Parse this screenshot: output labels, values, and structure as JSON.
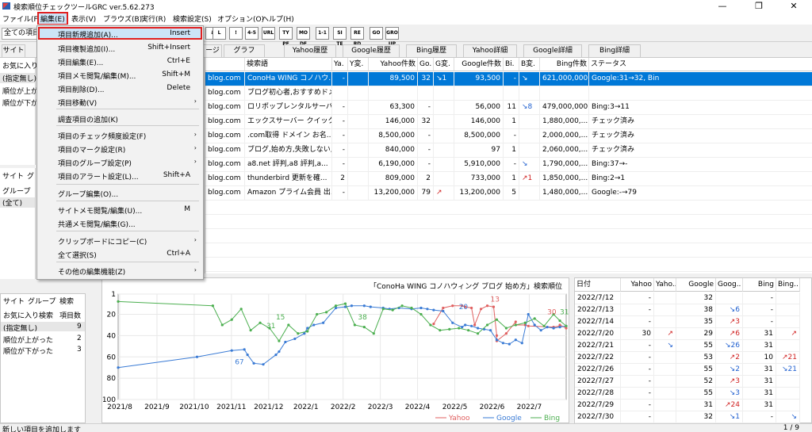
{
  "app": {
    "title": "検索順位チェックツールGRC  ver.5.62.273"
  },
  "window": {
    "minimize": "—",
    "restore": "❐",
    "close": "✕"
  },
  "menu": [
    "ファイル(F)",
    "編集(E)",
    "表示(V)",
    "ブラウズ(B)",
    "実行(R)",
    "検索設定(S)",
    "オプション(O)",
    "ヘルプ(H)"
  ],
  "filter": {
    "value": "全ての項目"
  },
  "toolbar": [
    "↓",
    "L",
    "!",
    "4-5",
    "URL",
    "TY PE",
    "MO DE",
    "1-1",
    "SI TE",
    "RE RD",
    "GO",
    "GRO UP"
  ],
  "tabs": [
    "サイト",
    "グラフ",
    "Yahoo履歴",
    "Google履歴",
    "Bing履歴",
    "Yahoo詳細",
    "Google詳細",
    "Bing詳細"
  ],
  "tab_partial": "ージ",
  "left_top": {
    "tabs": [
      "サイト",
      "グル"
    ],
    "items": [
      "お気に入り検",
      "(指定無し)",
      "順位が上が",
      "順位が下が"
    ]
  },
  "left_mid": {
    "tabs": [
      "サイト",
      "グ"
    ],
    "header": "グループ",
    "items": [
      "(全て)"
    ]
  },
  "left_bottom": {
    "tabs": [
      "サイト",
      "グループ",
      "検索"
    ],
    "headers": [
      "お気に入り検索",
      "項目数"
    ],
    "rows": [
      [
        "(指定無し)",
        "9"
      ],
      [
        "順位が上がった",
        "2"
      ],
      [
        "順位が下がった",
        "3"
      ]
    ]
  },
  "grid": {
    "headers": [
      "",
      "検索語",
      "Ya.",
      "Y変.",
      "Yahoo件数",
      "Go.",
      "G変.",
      "Google件数",
      "Bi.",
      "B変.",
      "Bing件数",
      "ステータス"
    ],
    "rows": [
      [
        "blog.com",
        "ConoHa WING コノハウ...",
        "-",
        "",
        "89,500",
        "32",
        "↘1",
        "93,500",
        "-",
        "↘",
        "621,000,000",
        "Google:31→32, Bin"
      ],
      [
        "blog.com",
        "ブログ初心者,おすすめドメ...",
        "",
        "",
        "",
        "",
        "",
        "",
        "",
        "",
        "",
        ""
      ],
      [
        "blog.com",
        "ロリポップレンタルサーバー,...",
        "-",
        "",
        "63,300",
        "-",
        "",
        "56,000",
        "11",
        "↘8",
        "479,000,000",
        "Bing:3→11"
      ],
      [
        "blog.com",
        "エックスサーバー クイックスタ...",
        "-",
        "",
        "146,000",
        "32",
        "",
        "146,000",
        "1",
        "",
        "1,880,000,...",
        "チェック済み"
      ],
      [
        "blog.com",
        ".com取得 ドメイン お名...",
        "-",
        "",
        "8,500,000",
        "-",
        "",
        "8,500,000",
        "-",
        "",
        "2,000,000,...",
        "チェック済み"
      ],
      [
        "blog.com",
        "ブログ,始め方,失敗しない,...",
        "-",
        "",
        "840,000",
        "-",
        "",
        "97",
        "1",
        "",
        "2,060,000,...",
        "チェック済み"
      ],
      [
        "blog.com",
        "a8.net 評判,a8 評判,a...",
        "-",
        "",
        "6,190,000",
        "-",
        "",
        "5,910,000",
        "-",
        "↘",
        "1,790,000,...",
        "Bing:37→-"
      ],
      [
        "blog.com",
        "thunderbird 更新を確...",
        "2",
        "",
        "809,000",
        "2",
        "",
        "733,000",
        "1",
        "↗1",
        "1,850,000,...",
        "Bing:2→1"
      ],
      [
        "blog.com",
        "Amazon プライム会員 出...",
        "-",
        "",
        "13,200,000",
        "79",
        "↗",
        "13,200,000",
        "5",
        "",
        "1,480,000,...",
        "Google:-→79"
      ]
    ]
  },
  "dropdown": {
    "items": [
      {
        "label": "項目新規追加(A)...",
        "shortcut": "Insert"
      },
      {
        "label": "項目複製追加(I)...",
        "shortcut": "Shift+Insert"
      },
      {
        "label": "項目編集(E)...",
        "shortcut": "Ctrl+E"
      },
      {
        "label": "項目メモ閲覧/編集(M)...",
        "shortcut": "Shift+M"
      },
      {
        "label": "項目削除(D)...",
        "shortcut": "Delete"
      },
      {
        "label": "項目移動(V)",
        "shortcut": ""
      },
      {
        "label": "調査項目の追加(K)",
        "shortcut": ""
      },
      {
        "label": "項目のチェック頻度設定(F)",
        "shortcut": ""
      },
      {
        "label": "項目のマーク設定(R)",
        "shortcut": ""
      },
      {
        "label": "項目のグループ設定(P)",
        "shortcut": ""
      },
      {
        "label": "項目のアラート設定(L)...",
        "shortcut": "Shift+A"
      },
      {
        "label": "グループ編集(O)...",
        "shortcut": ""
      },
      {
        "label": "サイトメモ閲覧/編集(U)...",
        "shortcut": "M"
      },
      {
        "label": "共通メモ閲覧/編集(G)...",
        "shortcut": ""
      },
      {
        "label": "クリップボードにコピー(C)",
        "shortcut": ""
      },
      {
        "label": "全て選択(S)",
        "shortcut": "Ctrl+A"
      },
      {
        "label": "その他の編集機能(Z)",
        "shortcut": ""
      }
    ]
  },
  "chart_data": {
    "type": "line",
    "title": "「ConoHa WING コノハウィング ブログ 始め方」検索順位",
    "x_ticks": [
      "2021/8",
      "2021/9",
      "2021/10",
      "2021/11",
      "2021/12",
      "2022/1",
      "2022/2",
      "2022/3",
      "2022/4",
      "2022/5",
      "2022/6",
      "2022/7"
    ],
    "y_ticks": [
      1,
      20,
      40,
      60,
      80,
      100
    ],
    "ylim": [
      1,
      100
    ],
    "y_inverted": true,
    "annotations": [
      "13",
      "20",
      "38",
      "30",
      "31",
      "67",
      "15",
      "31"
    ],
    "series": [
      {
        "name": "Yahoo",
        "color": "#e06060",
        "x": [
          10.0,
          10.3,
          10.6,
          10.9,
          11.0,
          11.2,
          11.3,
          11.5,
          11.7,
          11.9,
          12.0,
          12.0,
          12.3,
          12.6,
          12.6,
          12.9,
          13.0,
          13.8,
          14.0,
          14.0,
          14.2
        ],
        "y": [
          29,
          14,
          12,
          12,
          13,
          14,
          30,
          15,
          12,
          13,
          40,
          45,
          38,
          27,
          30,
          30,
          31,
          32,
          31,
          30,
          33
        ]
      },
      {
        "name": "Google",
        "color": "#3a7bd5",
        "x": [
          0.0,
          2.5,
          3.6,
          4.0,
          4.1,
          4.3,
          4.6,
          5.0,
          5.1,
          5.3,
          5.6,
          5.9,
          6.0,
          6.2,
          6.5,
          6.9,
          7.2,
          7.4,
          7.8,
          8.0,
          8.4,
          8.6,
          8.9,
          9.3,
          9.6,
          9.8,
          10.0,
          10.3,
          10.6,
          10.9,
          11.0,
          11.2,
          11.4,
          11.6,
          11.8,
          12.0,
          12.2,
          12.4,
          12.6,
          12.8,
          13.0,
          13.2,
          13.4,
          13.6,
          13.8,
          14.0,
          14.2
        ],
        "y": [
          70,
          60,
          54,
          53,
          58,
          66,
          67,
          58,
          55,
          46,
          43,
          38,
          33,
          30,
          28,
          14,
          13,
          12,
          12,
          13,
          14,
          15,
          14,
          15,
          14,
          15,
          16,
          17,
          28,
          32,
          30,
          31,
          33,
          34,
          35,
          44,
          47,
          48,
          44,
          47,
          20,
          30,
          35,
          32,
          33,
          32,
          31
        ]
      },
      {
        "name": "Bing",
        "color": "#4caf50",
        "x": [
          0.0,
          3.0,
          3.3,
          3.6,
          3.9,
          4.2,
          4.5,
          4.8,
          5.1,
          5.4,
          5.7,
          6.0,
          6.3,
          6.6,
          6.9,
          7.2,
          7.5,
          7.8,
          8.1,
          8.4,
          8.7,
          9.0,
          9.3,
          9.6,
          9.9,
          10.2,
          10.5,
          10.8,
          11.1,
          11.4,
          11.7,
          12.0,
          12.3,
          12.6,
          12.9,
          13.2,
          13.5,
          13.8,
          14.0,
          14.2
        ],
        "y": [
          8,
          12,
          30,
          25,
          15,
          35,
          28,
          33,
          45,
          30,
          38,
          36,
          20,
          18,
          12,
          10,
          30,
          32,
          38,
          15,
          16,
          12,
          14,
          20,
          30,
          35,
          34,
          33,
          35,
          38,
          30,
          25,
          33,
          30,
          28,
          24,
          31,
          20,
          26,
          31
        ]
      }
    ],
    "legend": [
      "Yahoo",
      "Google",
      "Bing"
    ]
  },
  "rtable": {
    "headers": [
      "日付",
      "Yahoo",
      "Yaho..",
      "Google",
      "Goog..",
      "Bing",
      "Bing.."
    ],
    "rows": [
      [
        "2022/7/12",
        "-",
        "",
        "32",
        "",
        "-",
        ""
      ],
      [
        "2022/7/13",
        "-",
        "",
        "38",
        "↘6",
        "-",
        ""
      ],
      [
        "2022/7/14",
        "-",
        "",
        "35",
        "↗3",
        "-",
        ""
      ],
      [
        "2022/7/20",
        "30",
        "↗",
        "29",
        "↗6",
        "31",
        "↗"
      ],
      [
        "2022/7/21",
        "-",
        "↘",
        "55",
        "↘26",
        "31",
        ""
      ],
      [
        "2022/7/22",
        "-",
        "",
        "53",
        "↗2",
        "10",
        "↗21"
      ],
      [
        "2022/7/26",
        "-",
        "",
        "55",
        "↘2",
        "31",
        "↘21"
      ],
      [
        "2022/7/27",
        "-",
        "",
        "52",
        "↗3",
        "31",
        ""
      ],
      [
        "2022/7/28",
        "-",
        "",
        "55",
        "↘3",
        "31",
        ""
      ],
      [
        "2022/7/29",
        "-",
        "",
        "31",
        "↗24",
        "31",
        ""
      ],
      [
        "2022/7/30",
        "-",
        "",
        "32",
        "↘1",
        "-",
        "↘"
      ]
    ]
  },
  "status": {
    "left": "新しい項目を追加します",
    "right": "1 / 9"
  }
}
